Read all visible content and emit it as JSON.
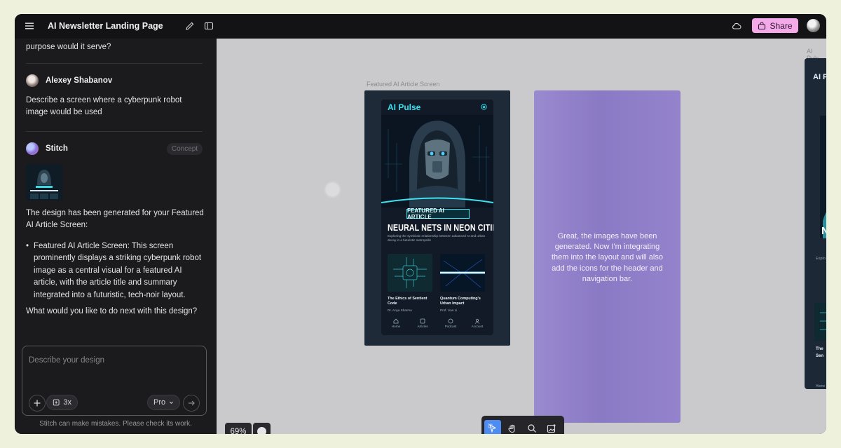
{
  "header": {
    "title": "AI Newsletter Landing Page",
    "share_label": "Share"
  },
  "chat": {
    "prev_text": "purpose would it serve?",
    "user_name": "Alexey Shabanov",
    "user_message": "Describe a screen where a cyberpunk robot image would be used",
    "bot_name": "Stitch",
    "bot_badge": "Concept",
    "bot_intro": "The design has been generated for your Featured AI Article Screen:",
    "bullet": "Featured AI Article Screen: This screen prominently displays a striking cyberpunk robot image as a central visual for a featured AI article, with the article title and summary integrated into a futuristic, tech-noir layout.",
    "follow_up": "What would you like to do next with this design?"
  },
  "composer": {
    "placeholder": "Describe your design",
    "variants_label": "3x",
    "model_label": "Pro",
    "disclaimer": "Stitch can make mistakes. Please check its work."
  },
  "canvas": {
    "frame_label": "Featured AI Article Screen",
    "right_frame_label": "AI Puls",
    "zoom_label": "69%",
    "status_message": "Great, the images have been generated. Now I'm integrating them into the layout and will also add the icons for the header and navigation bar."
  },
  "mockup": {
    "brand": "AI Pulse",
    "tag": "FEATURED AI ARTICLE",
    "headline": "NEURAL NETS IN NEON CITIES",
    "summary": "Exploring the symbiotic relationship between advanced AI and urban decay in a futuristic metropolis",
    "cards": [
      {
        "title": "The Ethics of Sentient Code",
        "author": "Dr. Anya Sharma"
      },
      {
        "title": "Quantum Computing's Urban Impact",
        "author": "Prof. Jian Li"
      }
    ],
    "nav": [
      "Home",
      "Articles",
      "Podcast",
      "Account"
    ]
  },
  "right_mockup": {
    "title": "AI P",
    "headline_fragment": "N",
    "summary_fragment": "Explo",
    "card_title_fragment": "The\nSen",
    "nav_fragment": "Home"
  },
  "colors": {
    "accent_share": "#f4a9e8",
    "accent_tool": "#4e8cf2",
    "neon_cyan": "#38e0f0",
    "status_frame": "#9a8ad0"
  }
}
